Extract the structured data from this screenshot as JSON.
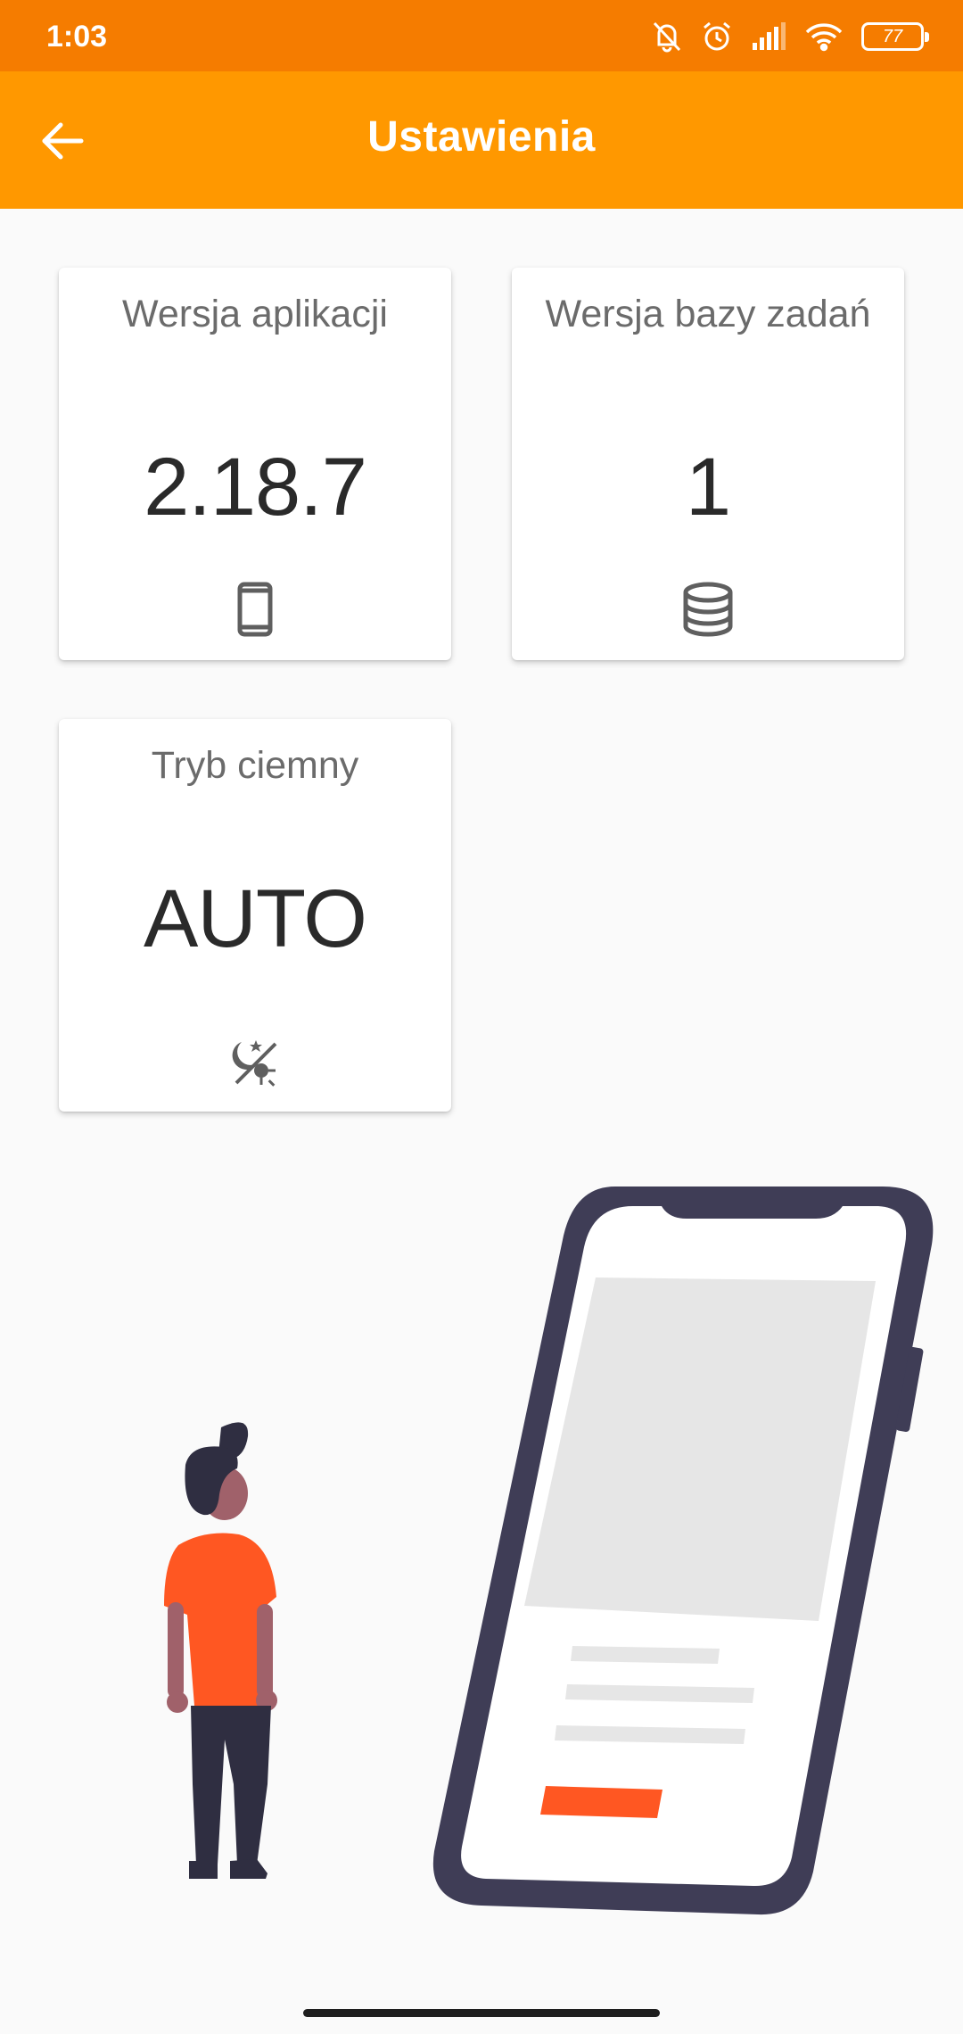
{
  "status_bar": {
    "time": "1:03",
    "battery": "77",
    "icons": [
      "notifications-off-icon",
      "alarm-icon",
      "signal-icon",
      "wifi-icon",
      "battery-icon"
    ]
  },
  "app_bar": {
    "title": "Ustawienia",
    "back_icon": "arrow-back-icon",
    "color": "#ff9800"
  },
  "cards": {
    "app_version": {
      "title": "Wersja aplikacji",
      "value": "2.18.7",
      "icon": "smartphone-icon"
    },
    "db_version": {
      "title": "Wersja bazy zadań",
      "value": "1",
      "icon": "database-icon"
    },
    "dark_mode": {
      "title": "Tryb ciemny",
      "value": "AUTO",
      "icon": "dark-mode-auto-icon"
    }
  },
  "colors": {
    "status_bar": "#f57c00",
    "accent": "#ff9800",
    "illustration_accent": "#ff5722",
    "illustration_dark": "#3f3d56"
  }
}
